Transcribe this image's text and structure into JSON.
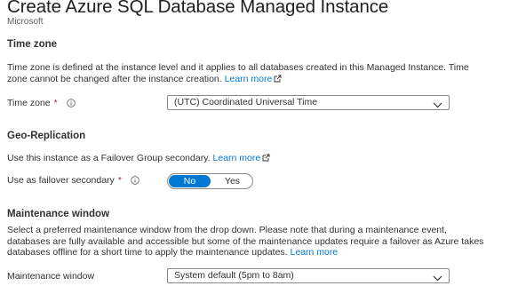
{
  "header": {
    "title": "Create Azure SQL Database Managed Instance",
    "more": "···",
    "publisher": "Microsoft"
  },
  "time_zone": {
    "heading": "Time zone",
    "description": "Time zone is defined at the instance level and it applies to all databases created in this Managed Instance. Time zone cannot be changed after the instance creation.",
    "link": "Learn more",
    "field_label": "Time zone",
    "required_mark": "*",
    "value": "(UTC) Coordinated Universal Time"
  },
  "geo": {
    "heading": "Geo-Replication",
    "description": "Use this instance as a Failover Group secondary.",
    "link": "Learn more",
    "field_label": "Use as failover secondary",
    "required_mark": "*",
    "options": [
      "No",
      "Yes"
    ],
    "selected": "No"
  },
  "maintenance": {
    "heading": "Maintenance window",
    "description": "Select a preferred maintenance window from the drop down. Please note that during a maintenance event, databases are fully available and accessible but some of the maintenance updates require a failover as Azure takes databases offline for a short time to apply the maintenance updates.",
    "link": "Learn more",
    "field_label": "Maintenance window",
    "value": "System default (5pm to 8am)"
  },
  "colors": {
    "accent": "#0078d4",
    "required": "#a4262c",
    "text": "#323130",
    "border": "#8a8886"
  },
  "icons": {
    "info": "info-icon",
    "external": "external-link-icon",
    "chevron": "chevron-down-icon"
  }
}
